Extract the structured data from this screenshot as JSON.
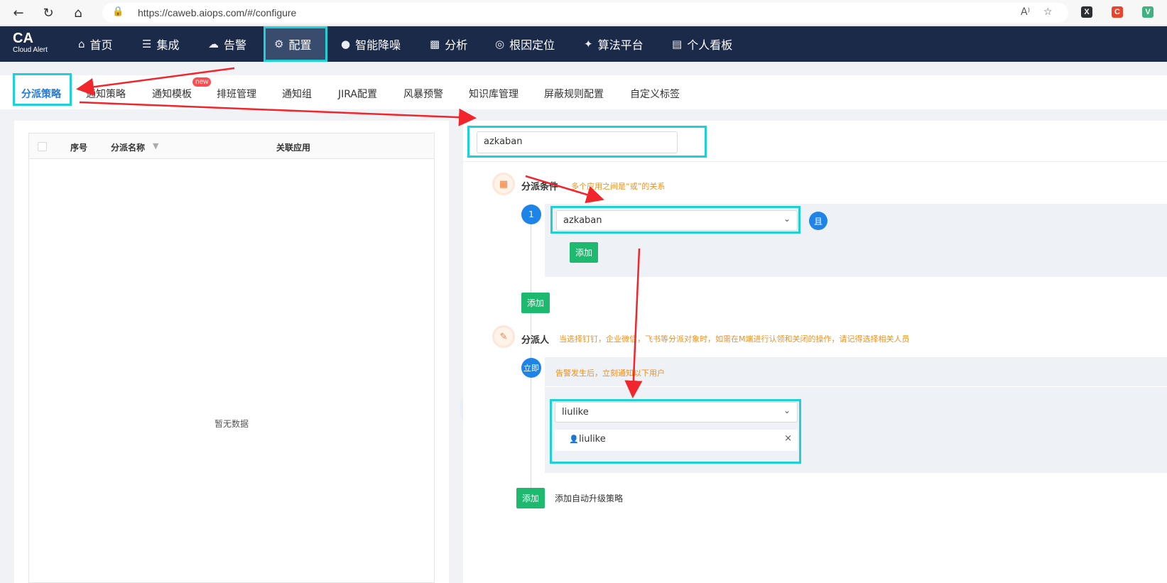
{
  "browser": {
    "url": "https://caweb.aiops.com/#/configure",
    "read_aloud_label": "A⁾"
  },
  "logo": {
    "line1": "CA",
    "line2": "Cloud Alert"
  },
  "nav": [
    {
      "label": "首页",
      "icon": "home-icon"
    },
    {
      "label": "集成",
      "icon": "layers-icon"
    },
    {
      "label": "告警",
      "icon": "alarm-icon"
    },
    {
      "label": "配置",
      "icon": "gear-icon"
    },
    {
      "label": "智能降噪",
      "icon": "noise-reduction-icon"
    },
    {
      "label": "分析",
      "icon": "bar-chart-icon"
    },
    {
      "label": "根因定位",
      "icon": "target-icon"
    },
    {
      "label": "算法平台",
      "icon": "algorithm-icon"
    },
    {
      "label": "个人看板",
      "icon": "dashboard-icon"
    }
  ],
  "subtabs": [
    {
      "label": "分派策略",
      "active": true
    },
    {
      "label": "通知策略"
    },
    {
      "label": "通知模板",
      "badge": "new"
    },
    {
      "label": "排班管理"
    },
    {
      "label": "通知组"
    },
    {
      "label": "JIRA配置"
    },
    {
      "label": "风暴预警"
    },
    {
      "label": "知识库管理"
    },
    {
      "label": "屏蔽规则配置"
    },
    {
      "label": "自定义标签"
    }
  ],
  "table": {
    "columns": [
      "序号",
      "分派名称",
      "关联应用"
    ],
    "empty_text": "暂无数据"
  },
  "form": {
    "name_value": "azkaban",
    "condition": {
      "title": "分派条件",
      "hint": "多个应用之间是“或”的关系",
      "step": "1",
      "app_select": "azkaban",
      "and_label": "且",
      "inner_add": "添加",
      "outer_add": "添加"
    },
    "assignee": {
      "title": "分派人",
      "hint": "当选择钉钉，企业微信，飞书等分派对象时，如需在M端进行认领和关闭的操作，请记得选择相关人员",
      "step": "立即",
      "sub_hint": "告警发生后，立刻通知以下用户",
      "user_select": "liulike",
      "selected_user": "liulike",
      "remove": "×",
      "add_button": "添加",
      "add_escalation": "添加自动升级策略"
    }
  },
  "colors": {
    "header_bg": "#1c2a4a",
    "highlight": "#1fd1d6",
    "annotation_arrow": "#f0262c",
    "primary": "#1f84e8",
    "green": "#1cb96e",
    "hint_orange": "#f0901e"
  }
}
